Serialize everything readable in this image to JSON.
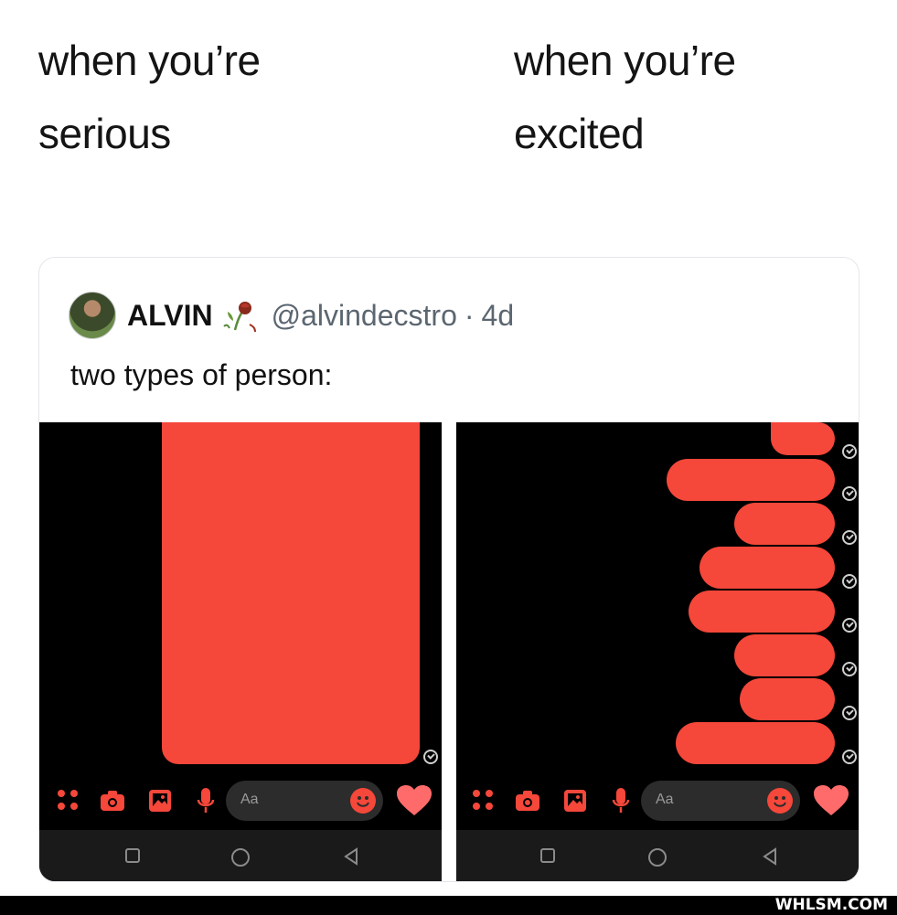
{
  "caption_left": {
    "line1": "when you’re",
    "line2": "serious"
  },
  "caption_right": {
    "line1": "when you’re",
    "line2": "excited"
  },
  "tweet": {
    "display_name": "ALVIN",
    "name_emoji": "wilted-rose-icon",
    "handle": "@alvindecstro",
    "separator": "·",
    "age": "4d",
    "text": "two types of person:"
  },
  "phone_left": {
    "compose_placeholder": "Aa"
  },
  "phone_right": {
    "compose_placeholder": "Aa"
  },
  "colors": {
    "bubble": "#f5473a",
    "background": "#000000",
    "compose": "#2c2c2c",
    "heart": "#ff6b6b"
  },
  "watermark": "WHLSM.COM"
}
